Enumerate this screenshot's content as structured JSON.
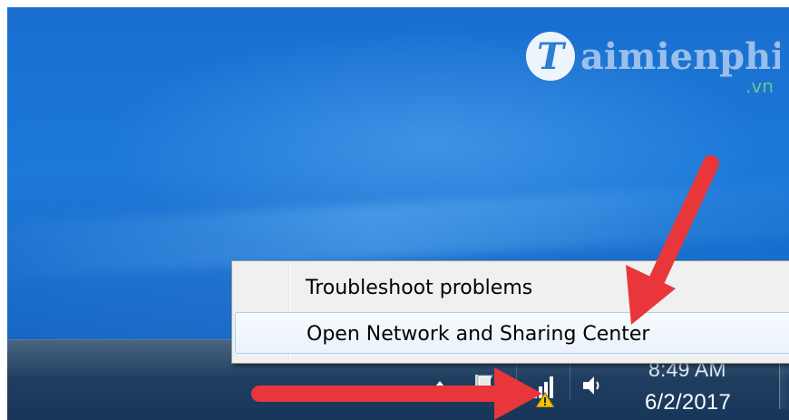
{
  "watermark": {
    "brand": "Taimienphi",
    "tld": ".vn"
  },
  "context_menu": {
    "items": [
      {
        "label": "Troubleshoot problems"
      },
      {
        "label": "Open Network and Sharing Center"
      }
    ]
  },
  "system_tray": {
    "icons": [
      "show-hidden-icons-arrow",
      "action-center-flag-icon",
      "network-signal-warning-icon",
      "volume-speaker-icon"
    ],
    "clock": {
      "time": "8:49 AM",
      "date": "6/2/2017"
    }
  },
  "annotations": {
    "arrow_color": "#e8363a"
  },
  "colors": {
    "desktop_blue": "#1a6fd0",
    "taskbar": "#1f3e60",
    "menu_bg": "#f0f0f0",
    "menu_hover_border": "#a8d1f5",
    "warning_yellow": "#f2c300"
  }
}
